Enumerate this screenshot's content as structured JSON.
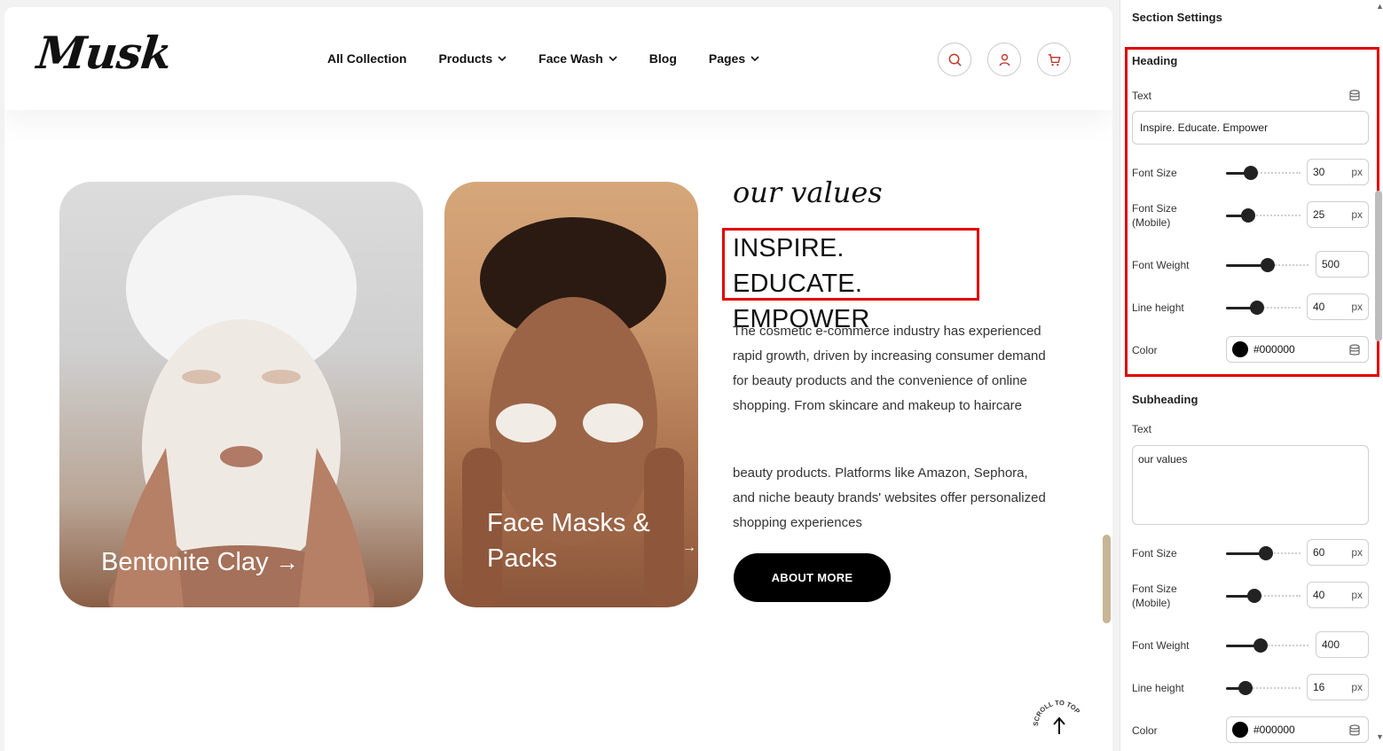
{
  "site": {
    "logo": "Musk",
    "nav": [
      "All Collection",
      "Products",
      "Face Wash",
      "Blog",
      "Pages"
    ],
    "nav_dropdown": [
      false,
      true,
      true,
      false,
      true
    ],
    "icons": [
      "search-icon",
      "user-icon",
      "cart-icon"
    ]
  },
  "cards": [
    {
      "label": "Bentonite Clay",
      "arrow": "→"
    },
    {
      "label": "Face Masks &\nPacks",
      "arrow": "→"
    }
  ],
  "content": {
    "subheading": "our values",
    "heading": "INSPIRE. EDUCATE. EMPOWER",
    "paragraph1": "The cosmetic e-commerce industry has experienced rapid growth, driven by increasing consumer demand for beauty products and the convenience of online shopping. From skincare and makeup to haircare",
    "paragraph2": "beauty products. Platforms like Amazon, Sephora, and niche beauty brands' websites offer personalized shopping experiences",
    "button": "ABOUT MORE",
    "scroll_top": "SCROLL TO TOP"
  },
  "panel": {
    "title": "Section Settings",
    "heading": {
      "title": "Heading",
      "text_label": "Text",
      "text_value": "Inspire. Educate. Empower",
      "font_size_label": "Font Size",
      "font_size": "30",
      "font_size_pct": 0.3,
      "font_size_mobile_label": "Font Size\n(Mobile)",
      "font_size_mobile": "25",
      "font_size_mobile_pct": 0.25,
      "font_weight_label": "Font Weight",
      "font_weight": "500",
      "font_weight_pct": 0.5,
      "line_height_label": "Line height",
      "line_height": "40",
      "line_height_pct": 0.4,
      "color_label": "Color",
      "color": "#000000"
    },
    "subheading": {
      "title": "Subheading",
      "text_label": "Text",
      "text_value": "our values",
      "font_size_label": "Font Size",
      "font_size": "60",
      "font_size_pct": 0.55,
      "font_size_mobile_label": "Font Size\n(Mobile)",
      "font_size_mobile": "40",
      "font_size_mobile_pct": 0.35,
      "font_weight_label": "Font Weight",
      "font_weight": "400",
      "font_weight_pct": 0.4,
      "line_height_label": "Line height",
      "line_height": "16",
      "line_height_pct": 0.2,
      "color_label": "Color",
      "color": "#000000"
    },
    "unit": "px"
  }
}
